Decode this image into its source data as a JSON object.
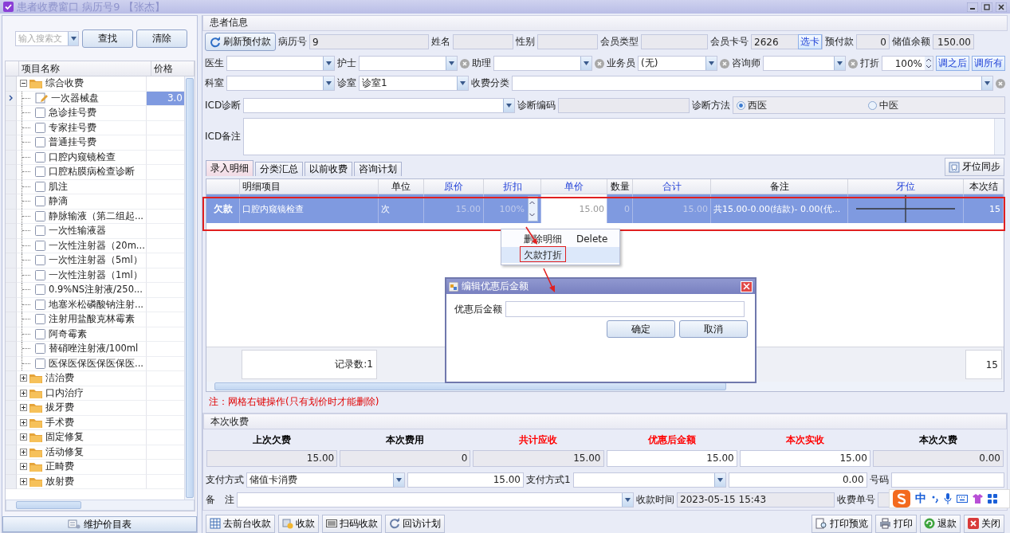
{
  "window": {
    "title": "患者收费窗口  病历号9 【张杰】"
  },
  "price_list": {
    "search": {
      "placeholder": "输入搜索文"
    },
    "buttons": [
      "查找",
      "清除"
    ],
    "columns": [
      "项目名称",
      "价格"
    ],
    "tree": [
      {
        "label": "综合收费",
        "expanded": true,
        "children": [
          {
            "label": "一次器械盘",
            "price": "3.0",
            "selected": true
          },
          {
            "label": "急诊挂号费",
            "selected": false
          },
          {
            "label": "专家挂号费",
            "selected": false
          },
          {
            "label": "普通挂号费",
            "selected": false
          },
          {
            "label": "口腔内窥镜检查",
            "selected": false
          },
          {
            "label": "口腔粘膜病检查诊断",
            "selected": false
          },
          {
            "label": "肌注",
            "selected": false
          },
          {
            "label": "静滴",
            "selected": false
          },
          {
            "label": "静脉输液（第二组起...",
            "selected": false
          },
          {
            "label": "一次性输液器",
            "selected": false
          },
          {
            "label": "一次性注射器（20m...",
            "selected": false
          },
          {
            "label": "一次性注射器（5ml）",
            "selected": false
          },
          {
            "label": "一次性注射器（1ml）",
            "selected": false
          },
          {
            "label": "0.9%NS注射液/250...",
            "selected": false
          },
          {
            "label": "地塞米松磷酸钠注射...",
            "selected": false
          },
          {
            "label": "注射用盐酸克林霉素",
            "selected": false
          },
          {
            "label": "阿奇霉素",
            "selected": false
          },
          {
            "label": "替硝唑注射液/100ml",
            "selected": false
          },
          {
            "label": "医保医保医保医保医...",
            "selected": false
          }
        ]
      },
      {
        "label": "洁治费",
        "expanded": false
      },
      {
        "label": "口内治疗",
        "expanded": false
      },
      {
        "label": "拔牙费",
        "expanded": false
      },
      {
        "label": "手术费",
        "expanded": false
      },
      {
        "label": "固定修复",
        "expanded": false
      },
      {
        "label": "活动修复",
        "expanded": false
      },
      {
        "label": "正畸费",
        "expanded": false
      },
      {
        "label": "放射费",
        "expanded": false
      }
    ],
    "footer_button": "维护价目表"
  },
  "patient_info": {
    "title": "患者信息",
    "refresh_button": "刷新预付款",
    "record_no": {
      "label": "病历号",
      "value": "9"
    },
    "name": {
      "label": "姓名"
    },
    "gender": {
      "label": "性别"
    },
    "member_type": {
      "label": "会员类型"
    },
    "card_no": {
      "label": "会员卡号",
      "value": "2626",
      "button": "选卡"
    },
    "prepaid": {
      "label": "预付款",
      "value": "0"
    },
    "balance": {
      "label": "储值余额",
      "value": "150.00"
    },
    "doctor": {
      "label": "医生"
    },
    "nurse": {
      "label": "护士"
    },
    "assistant": {
      "label": "助理"
    },
    "salesperson": {
      "label": "业务员",
      "value": "(无)"
    },
    "consultant": {
      "label": "咨询师"
    },
    "discount": {
      "label": "打折",
      "value": "100%"
    },
    "discount_buttons": [
      "调之后",
      "调所有"
    ],
    "department": {
      "label": "科室"
    },
    "room": {
      "label": "诊室",
      "value": "诊室1"
    },
    "fee_category": {
      "label": "收费分类"
    },
    "icd": {
      "label": "ICD诊断"
    },
    "diag_code": {
      "label": "诊断编码"
    },
    "diag_method": {
      "label": "诊断方法",
      "options": [
        {
          "label": "西医",
          "selected": true
        },
        {
          "label": "中医",
          "selected": false
        }
      ]
    },
    "icd_note": {
      "label": "ICD备注"
    }
  },
  "detail": {
    "tabs": [
      {
        "label": "录入明细",
        "selected": true
      },
      {
        "label": "分类汇总",
        "selected": false
      },
      {
        "label": "以前收费",
        "selected": false
      },
      {
        "label": "咨询计划",
        "selected": false
      }
    ],
    "sync_button": "牙位同步",
    "columns": [
      {
        "label": "明细项目",
        "editable": false
      },
      {
        "label": "单位",
        "editable": false
      },
      {
        "label": "原价",
        "editable": true
      },
      {
        "label": "折扣",
        "editable": true
      },
      {
        "label": "单价",
        "editable": true
      },
      {
        "label": "数量",
        "editable": false
      },
      {
        "label": "合计",
        "editable": true
      },
      {
        "label": "备注",
        "editable": false
      },
      {
        "label": "牙位",
        "editable": true
      },
      {
        "label": "本次结",
        "editable": false
      }
    ],
    "rows": [
      {
        "header": "欠款",
        "selected": true,
        "cells": [
          {
            "kind": "text",
            "text": "口腔内窥镜检查"
          },
          {
            "kind": "text",
            "text": "次"
          },
          {
            "kind": "muted",
            "text": "15.00"
          },
          {
            "kind": "spin",
            "text": "100%"
          },
          {
            "kind": "edit",
            "text": "15.00"
          },
          {
            "kind": "muted",
            "text": "0"
          },
          {
            "kind": "muted",
            "text": "15.00"
          },
          {
            "kind": "text",
            "text": "共15.00-0.00(结款)- 0.00(优..."
          },
          {
            "kind": "tooth"
          },
          {
            "kind": "number",
            "text": "15"
          }
        ]
      }
    ],
    "footer": {
      "count": "记录数:1",
      "total": "15"
    },
    "context_menu": [
      {
        "label": "删除明细",
        "shortcut": "Delete",
        "selected": false
      },
      {
        "label": "欠款打折",
        "selected": true
      }
    ],
    "dialog": {
      "title": "编辑优惠后金额",
      "label": "优惠后金额",
      "buttons": [
        "确定",
        "取消"
      ]
    },
    "note": "注：网格右键操作(只有划价时才能删除)"
  },
  "charge": {
    "title": "本次收费",
    "summary": [
      {
        "label": "上次欠费",
        "color": "#000000",
        "value": "15.00",
        "readonly": true
      },
      {
        "label": "本次费用",
        "color": "#000000",
        "value": "0",
        "readonly": true
      },
      {
        "label": "共计应收",
        "color": "#ff0000",
        "value": "15.00",
        "readonly": true
      },
      {
        "label": "优惠后金额",
        "color": "#ff0000",
        "value": "15.00",
        "readonly": false
      },
      {
        "label": "本次实收",
        "color": "#ff0000",
        "value": "15.00",
        "readonly": false
      },
      {
        "label": "本次欠费",
        "color": "#000000",
        "value": "0.00",
        "readonly": true
      }
    ],
    "payment": {
      "label": "支付方式",
      "method": "储值卡消费",
      "amount": "15.00",
      "label2": "支付方式1",
      "amount2": "0.00",
      "label3": "号码"
    },
    "remark": {
      "label": "备　注",
      "time_label": "收款时间",
      "time": "2023-05-15 15:43",
      "receipt_label": "收费单号"
    }
  },
  "ime": {
    "mode": "中"
  },
  "toolbar": {
    "left": [
      "去前台收款",
      "收款",
      "扫码收款",
      "回访计划"
    ],
    "right": [
      "打印预览",
      "打印",
      "退款",
      "关闭"
    ]
  }
}
